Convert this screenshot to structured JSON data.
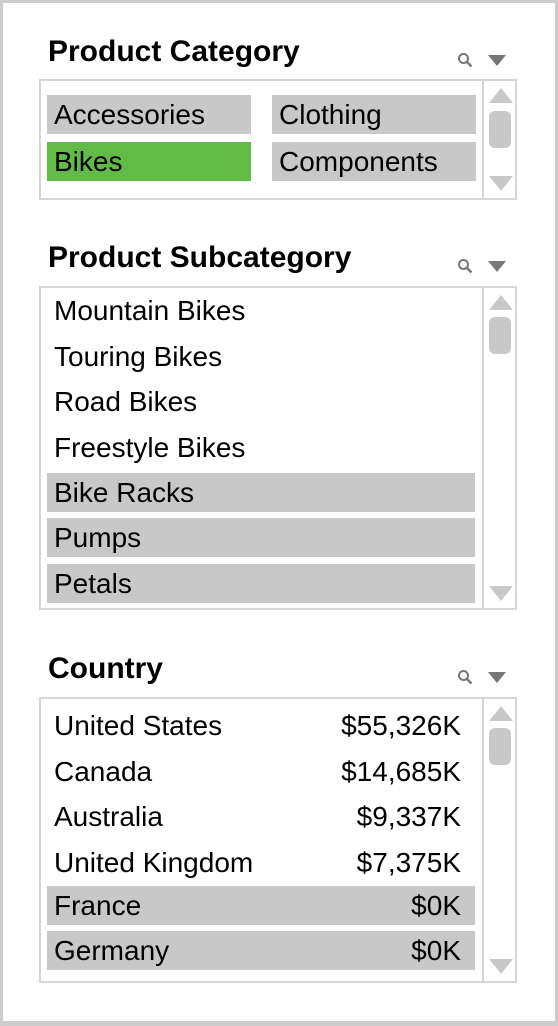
{
  "colors": {
    "selected": "#62bb46",
    "excluded": "#c8c8c8",
    "border": "#d6d6d6",
    "frame": "#cccccc"
  },
  "product_category": {
    "title": "Product Category",
    "icons": [
      "search-icon",
      "dropdown-arrow-icon"
    ],
    "items": [
      {
        "label": "Accessories",
        "state": "excluded"
      },
      {
        "label": "Clothing",
        "state": "excluded"
      },
      {
        "label": "Bikes",
        "state": "selected"
      },
      {
        "label": "Components",
        "state": "excluded"
      }
    ]
  },
  "product_subcategory": {
    "title": "Product Subcategory",
    "icons": [
      "search-icon",
      "dropdown-arrow-icon"
    ],
    "items": [
      {
        "label": "Mountain Bikes",
        "state": "normal"
      },
      {
        "label": "Touring Bikes",
        "state": "normal"
      },
      {
        "label": "Road Bikes",
        "state": "normal"
      },
      {
        "label": "Freestyle Bikes",
        "state": "normal"
      },
      {
        "label": "Bike Racks",
        "state": "excluded"
      },
      {
        "label": "Pumps",
        "state": "excluded"
      },
      {
        "label": "Petals",
        "state": "excluded"
      }
    ]
  },
  "country": {
    "title": "Country",
    "icons": [
      "search-icon",
      "dropdown-arrow-icon"
    ],
    "items": [
      {
        "label": "United States",
        "value": "$55,326K",
        "state": "normal"
      },
      {
        "label": "Canada",
        "value": "$14,685K",
        "state": "normal"
      },
      {
        "label": "Australia",
        "value": "$9,337K",
        "state": "normal"
      },
      {
        "label": "United Kingdom",
        "value": "$7,375K",
        "state": "normal"
      },
      {
        "label": "France",
        "value": "$0K",
        "state": "excluded"
      },
      {
        "label": "Germany",
        "value": "$0K",
        "state": "excluded"
      }
    ]
  }
}
